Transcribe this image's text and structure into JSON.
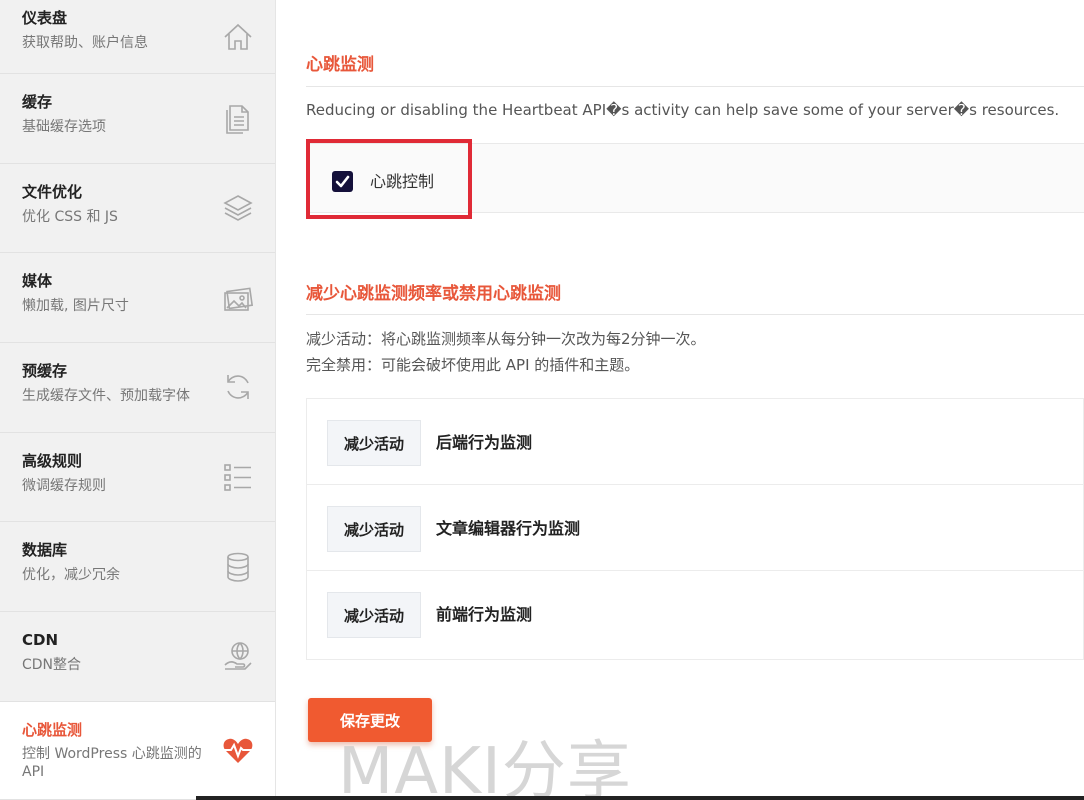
{
  "sidebar": {
    "items": [
      {
        "title": "仪表盘",
        "sub": "获取帮助、账户信息",
        "icon": "home-icon"
      },
      {
        "title": "缓存",
        "sub": "基础缓存选项",
        "icon": "document-icon"
      },
      {
        "title": "文件优化",
        "sub": "优化 CSS 和 JS",
        "icon": "layers-icon"
      },
      {
        "title": "媒体",
        "sub": "懒加载, 图片尺寸",
        "icon": "images-icon"
      },
      {
        "title": "预缓存",
        "sub": "生成缓存文件、预加载字体",
        "icon": "refresh-icon"
      },
      {
        "title": "高级规则",
        "sub": "微调缓存规则",
        "icon": "list-icon"
      },
      {
        "title": "数据库",
        "sub": "优化，减少冗余",
        "icon": "database-icon"
      },
      {
        "title": "CDN",
        "sub": "CDN整合",
        "icon": "globe-hand-icon"
      },
      {
        "title": "心跳监测",
        "sub": "控制 WordPress 心跳监测的 API",
        "icon": "heartbeat-icon",
        "active": true
      }
    ]
  },
  "main": {
    "heartbeat_title": "心跳监测",
    "heartbeat_desc": "Reducing or disabling the Heartbeat API�s activity can help save some of your server�s resources.",
    "heartbeat_control_label": "心跳控制",
    "heartbeat_control_checked": true,
    "reduce_title": "减少心跳监测频率或禁用心跳监测",
    "reduce_desc_1": "减少活动：将心跳监测频率从每分钟一次改为每2分钟一次。",
    "reduce_desc_2": "完全禁用：可能会破坏使用此 API 的插件和主题。",
    "options": [
      {
        "value": "减少活动",
        "label": "后端行为监测"
      },
      {
        "value": "减少活动",
        "label": "文章编辑器行为监测"
      },
      {
        "value": "减少活动",
        "label": "前端行为监测"
      }
    ],
    "save_label": "保存更改"
  },
  "watermark": "MAKI分享",
  "colors": {
    "accent": "#e8573a",
    "highlight": "#e02a36",
    "checkbox": "#14103a",
    "button": "#f05a30"
  }
}
